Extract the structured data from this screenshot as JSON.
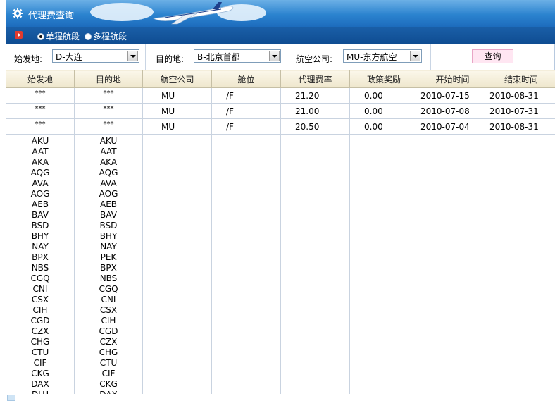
{
  "header": {
    "title": "代理费查询"
  },
  "radios": [
    {
      "label": "单程航段",
      "selected": true
    },
    {
      "label": "多程航段",
      "selected": false
    }
  ],
  "filters": {
    "origin_label": "始发地:",
    "origin_value": "D-大连",
    "dest_label": "目的地:",
    "dest_value": "B-北京首都",
    "airline_label": "航空公司:",
    "airline_value": "MU-东方航空",
    "query_label": "查询"
  },
  "table": {
    "columns": [
      "始发地",
      "目的地",
      "航空公司",
      "舱位",
      "代理费率",
      "政策奖励",
      "开始时间",
      "结束时间"
    ],
    "rows": [
      [
        "***",
        "***",
        "MU",
        "/F",
        "21.20",
        "0.00",
        "2010-07-15",
        "2010-08-31"
      ],
      [
        "***",
        "***",
        "MU",
        "/F",
        "21.00",
        "0.00",
        "2010-07-08",
        "2010-07-31"
      ],
      [
        "***",
        "***",
        "MU",
        "/F",
        "20.50",
        "0.00",
        "2010-07-04",
        "2010-08-31"
      ]
    ]
  },
  "origin_codes": [
    "AKU",
    "AAT",
    "AKA",
    "AQG",
    "AVA",
    "AOG",
    "AEB",
    "BAV",
    "BSD",
    "BHY",
    "NAY",
    "BPX",
    "NBS",
    "CGQ",
    "CNI",
    "CSX",
    "CIH",
    "CGD",
    "CZX",
    "CHG",
    "CTU",
    "CIF",
    "CKG",
    "DAX",
    "DLU"
  ],
  "dest_codes": [
    "AKU",
    "AAT",
    "AKA",
    "AQG",
    "AVA",
    "AOG",
    "AEB",
    "BAV",
    "BSD",
    "BHY",
    "NAY",
    "PEK",
    "BPX",
    "NBS",
    "CGQ",
    "CNI",
    "CSX",
    "CIH",
    "CGD",
    "CZX",
    "CHG",
    "CTU",
    "CIF",
    "CKG",
    "DAX"
  ],
  "colors": {
    "header_blue": "#2b83cf",
    "bar_blue": "#0f4d92",
    "query_pink": "#ffe6f2"
  }
}
